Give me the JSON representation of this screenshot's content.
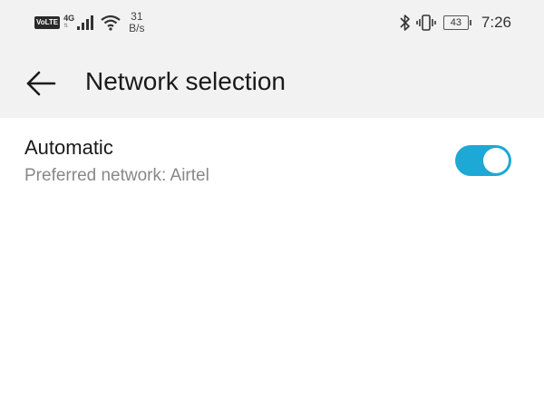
{
  "status_bar": {
    "volte": "VoLTE",
    "network_gen": "4G",
    "network_arrows": "⇅",
    "speed_value": "31",
    "speed_unit": "B/s",
    "battery": "43",
    "time": "7:26"
  },
  "app_bar": {
    "title": "Network selection"
  },
  "setting": {
    "title": "Automatic",
    "subtitle": "Preferred network: Airtel",
    "enabled": true
  },
  "colors": {
    "accent": "#1ea8d6",
    "header_bg": "#f2f2f2"
  }
}
